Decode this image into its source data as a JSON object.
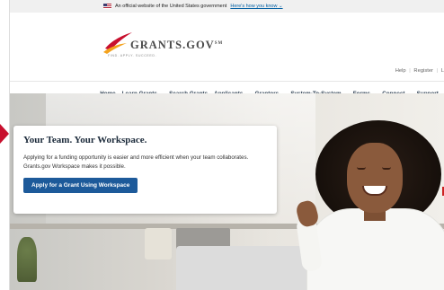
{
  "gov_banner": {
    "text": "An official website of the United States government",
    "link": "Here's how you know",
    "link_chevron": "⌄"
  },
  "header": {
    "logo_text": "GRANTS.GOV",
    "logo_trademark": "SM",
    "logo_tagline": "FIND. APPLY. SUCCEED.",
    "utility_links": [
      "Help",
      "Register",
      "L"
    ]
  },
  "nav": {
    "items": [
      {
        "label": "Home",
        "has_menu": false
      },
      {
        "label": "Learn Grants",
        "has_menu": true
      },
      {
        "label": "Search Grants",
        "has_menu": false
      },
      {
        "label": "Applicants",
        "has_menu": true
      },
      {
        "label": "Grantors",
        "has_menu": true
      },
      {
        "label": "System-To-System",
        "has_menu": true
      },
      {
        "label": "Forms",
        "has_menu": true
      },
      {
        "label": "Connect",
        "has_menu": true
      },
      {
        "label": "Support",
        "has_menu": true
      }
    ],
    "chevron": "⌄"
  },
  "hero_card": {
    "title": "Your Team. Your Workspace.",
    "description": "Applying for a funding opportunity is easier and more efficient when your team collaborates. Grants.gov Workspace makes it possible.",
    "button_label": "Apply for a Grant Using Workspace"
  },
  "colors": {
    "primary_button": "#1d5a9a",
    "nav_text": "#2c3e50",
    "banner_link": "#005ea2",
    "logo_swoosh_red": "#c8102e",
    "logo_swoosh_orange": "#f4a21d"
  }
}
